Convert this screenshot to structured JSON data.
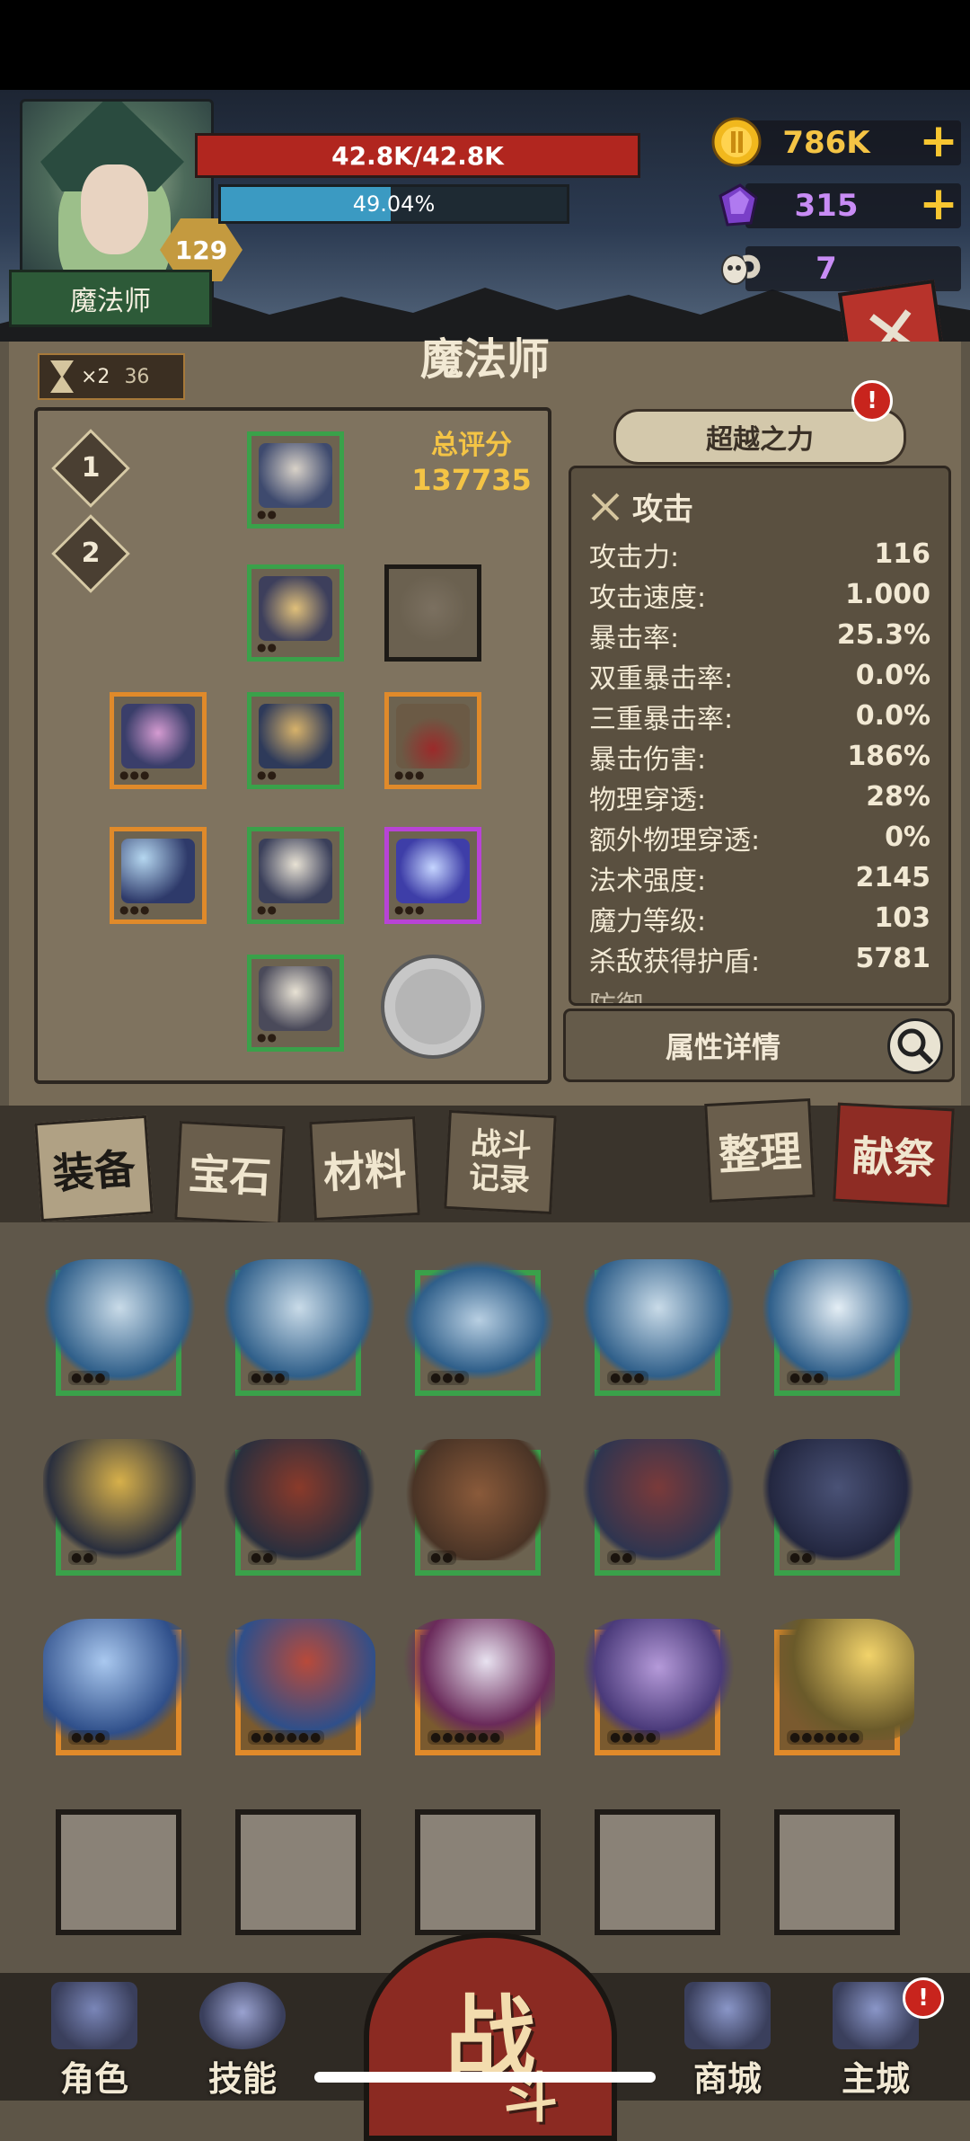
{
  "hero": {
    "class_name": "魔法师",
    "level": "129",
    "hp_text": "42.8K/42.8K",
    "xp_text": "49.04%",
    "xp_fraction": 0.4904
  },
  "resources": {
    "gold": "786K",
    "gems": "315",
    "skulls": "7",
    "plus": "+"
  },
  "panel": {
    "title": "魔法师",
    "speed_multiplier": "×2",
    "speed_count": "36",
    "loadouts": [
      "1",
      "2"
    ],
    "score_label": "总评分",
    "score_value": "137735",
    "beyond_button": "超越之力",
    "details_button": "属性详情",
    "alert": "!"
  },
  "stats": {
    "section_title": "攻击",
    "rows": [
      {
        "label": "攻击力:",
        "value": "116"
      },
      {
        "label": "攻击速度:",
        "value": "1.000"
      },
      {
        "label": "暴击率:",
        "value": "25.3%"
      },
      {
        "label": "双重暴击率:",
        "value": "0.0%"
      },
      {
        "label": "三重暴击率:",
        "value": "0.0%"
      },
      {
        "label": "暴击伤害:",
        "value": "186%"
      },
      {
        "label": "物理穿透:",
        "value": "28%"
      },
      {
        "label": "额外物理穿透:",
        "value": "0%"
      },
      {
        "label": "法术强度:",
        "value": "2145"
      },
      {
        "label": "魔力等级:",
        "value": "103"
      },
      {
        "label": "杀敌获得护盾:",
        "value": "5781"
      }
    ],
    "next_section_partial": "防御"
  },
  "tabs": {
    "equipment": "装备",
    "gems": "宝石",
    "materials": "材料",
    "battle_log_1": "战斗",
    "battle_log_2": "记录",
    "organize": "整理",
    "sacrifice": "献祭"
  },
  "nav": {
    "character": "角色",
    "skills": "技能",
    "battle_big": "战",
    "battle_small": "斗",
    "shop": "商城",
    "city": "主城",
    "alert": "!"
  },
  "colors": {
    "rarity_green": "#3aa14a",
    "rarity_orange": "#e08a2a",
    "rarity_purple": "#b843d6",
    "hp_red": "#b1261f",
    "xp_blue": "#3b9ac2",
    "gold": "#f4c445"
  },
  "icons": {
    "gold": "gold-coin-icon",
    "gems": "purple-crystal-icon",
    "skulls": "ram-skull-icon",
    "close": "close-x-icon",
    "hourglass": "hourglass-icon",
    "attack": "crossed-swords-icon",
    "search": "magnifier-icon"
  }
}
